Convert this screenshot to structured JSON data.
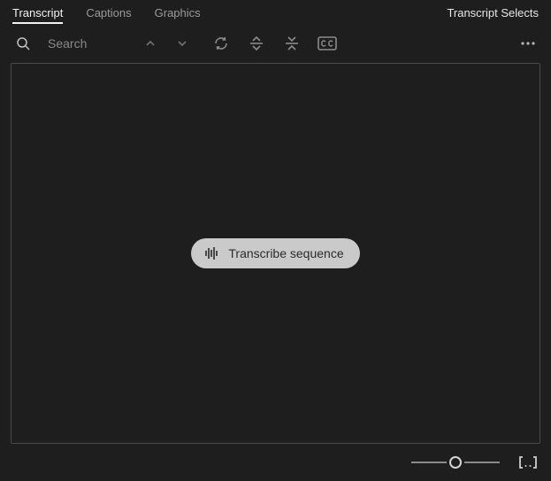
{
  "tabs": {
    "transcript": "Transcript",
    "captions": "Captions",
    "graphics": "Graphics",
    "selects": "Transcript Selects"
  },
  "toolbar": {
    "search_placeholder": "Search"
  },
  "main": {
    "transcribe_label": "Transcribe sequence"
  }
}
